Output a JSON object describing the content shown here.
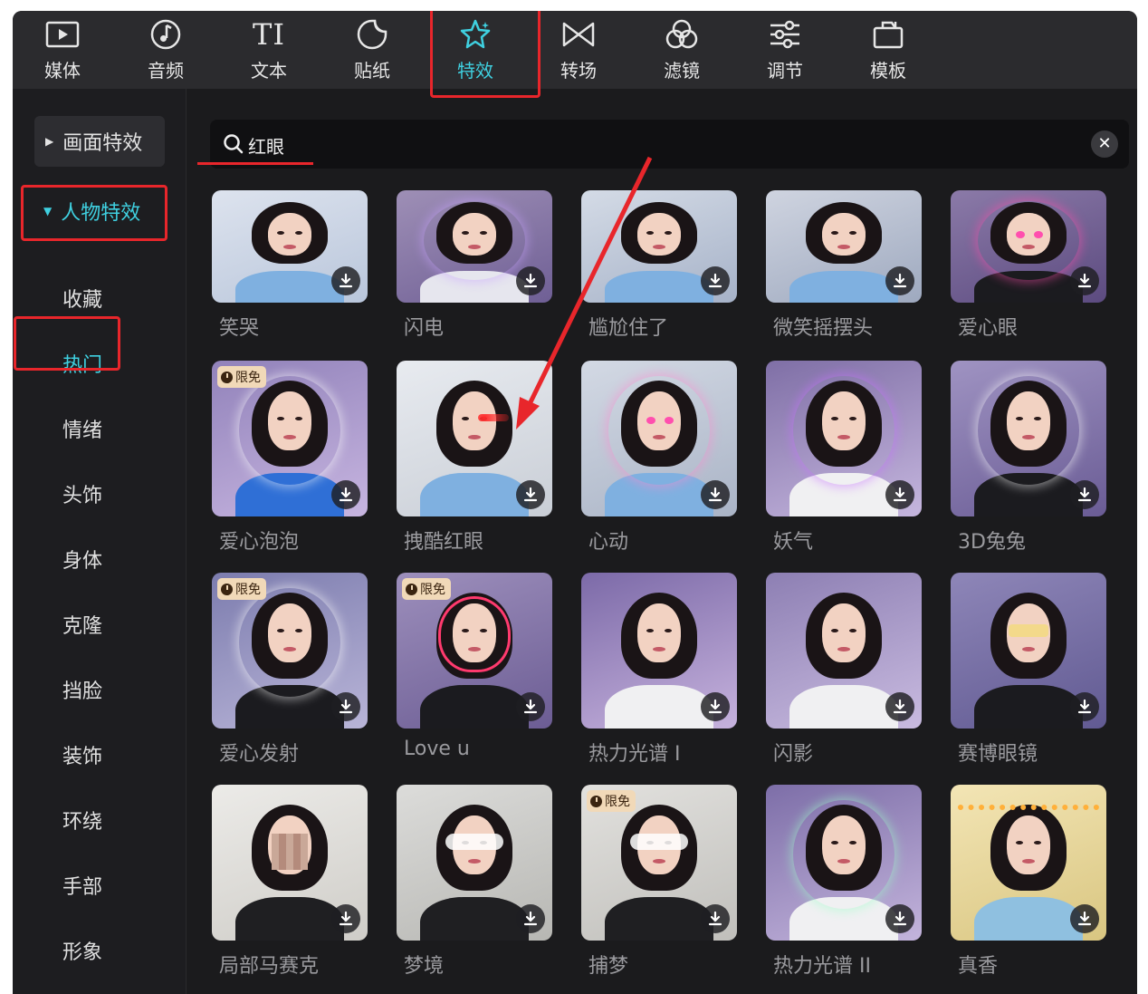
{
  "toolbar": {
    "items": [
      {
        "label": "媒体",
        "icon": "play-square-icon"
      },
      {
        "label": "音频",
        "icon": "music-note-icon"
      },
      {
        "label": "文本",
        "icon": "text-TI-icon"
      },
      {
        "label": "贴纸",
        "icon": "sticker-icon"
      },
      {
        "label": "特效",
        "icon": "star-effects-icon",
        "active": true
      },
      {
        "label": "转场",
        "icon": "transition-bowtie-icon"
      },
      {
        "label": "滤镜",
        "icon": "filter-circles-icon"
      },
      {
        "label": "调节",
        "icon": "adjust-sliders-icon"
      },
      {
        "label": "模板",
        "icon": "template-icon"
      }
    ]
  },
  "sidebar": {
    "screen_effects": "画面特效",
    "person_effects": "人物特效",
    "subcategories": [
      "收藏",
      "热门",
      "情绪",
      "头饰",
      "身体",
      "克隆",
      "挡脸",
      "装饰",
      "环绕",
      "手部",
      "形象"
    ],
    "active_sub": "热门"
  },
  "search": {
    "query": "红眼",
    "clear_icon": "✕"
  },
  "badge_text": "限免",
  "effects": [
    {
      "name": "笑哭"
    },
    {
      "name": "闪电"
    },
    {
      "name": "尴尬住了"
    },
    {
      "name": "微笑摇摆头"
    },
    {
      "name": "爱心眼"
    },
    {
      "name": "爱心泡泡",
      "badge": true
    },
    {
      "name": "拽酷红眼"
    },
    {
      "name": "心动"
    },
    {
      "name": "妖气"
    },
    {
      "name": "3D兔兔"
    },
    {
      "name": "爱心发射",
      "badge": true
    },
    {
      "name": "Love u",
      "badge": true
    },
    {
      "name": "热力光谱 I"
    },
    {
      "name": "闪影"
    },
    {
      "name": "赛博眼镜"
    },
    {
      "name": "局部马赛克"
    },
    {
      "name": "梦境"
    },
    {
      "name": "捕梦",
      "badge": true
    },
    {
      "name": "热力光谱 II"
    },
    {
      "name": "真香"
    }
  ],
  "colors": {
    "accent": "#3fd0e0",
    "highlight_annotation": "#e8262b",
    "panel_bg": "#1b1b1d",
    "toolbar_bg": "#2b2b2e"
  }
}
